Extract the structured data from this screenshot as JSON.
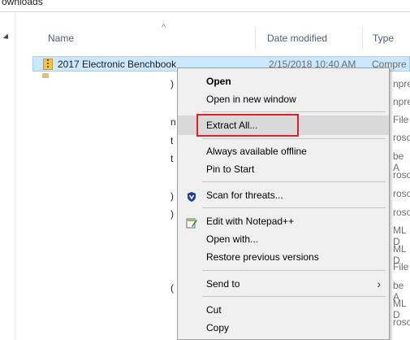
{
  "address": {
    "text": "ownloads"
  },
  "columns": {
    "name": "Name",
    "date": "Date modified",
    "type": "Type"
  },
  "file": {
    "name": "2017 Electronic Benchbook",
    "date": "2/15/2018 10:40 AM",
    "type": "Compre"
  },
  "right_partials": [
    "npre",
    "npre",
    "File",
    "roso",
    "be A",
    "roso",
    "roso",
    "roso",
    "ML D",
    "ML D",
    "File",
    "be A",
    "ML D",
    "roso"
  ],
  "left_partials": [
    ")",
    "n",
    "t",
    "t",
    ")",
    ")",
    "("
  ],
  "menu": {
    "open": "Open",
    "open_new_window": "Open in new window",
    "extract_all": "Extract All...",
    "always_offline": "Always available offline",
    "pin_to_start": "Pin to Start",
    "scan_threats": "Scan for threats...",
    "edit_notepad": "Edit with Notepad++",
    "open_with": "Open with...",
    "restore_versions": "Restore previous versions",
    "send_to": "Send to",
    "cut": "Cut",
    "copy": "Copy"
  },
  "colors": {
    "selection": "#cce8ff",
    "highlight_box": "#d9202b",
    "menu_bg": "#f0f0f0"
  }
}
